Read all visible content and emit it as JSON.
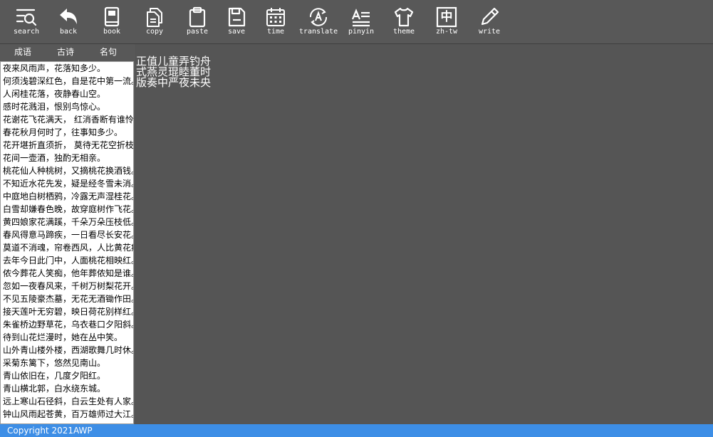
{
  "toolbar": {
    "items": [
      {
        "label": "search",
        "icon": "search-icon"
      },
      {
        "label": "back",
        "icon": "back-arrow-icon"
      },
      {
        "label": "book",
        "icon": "book-icon"
      },
      {
        "label": "copy",
        "icon": "copy-icon"
      },
      {
        "label": "paste",
        "icon": "clipboard-icon"
      },
      {
        "label": "save",
        "icon": "save-icon"
      },
      {
        "label": "time",
        "icon": "calendar-icon"
      },
      {
        "label": "translate",
        "icon": "translate-icon"
      },
      {
        "label": "pinyin",
        "icon": "pinyin-icon"
      },
      {
        "label": "theme",
        "icon": "shirt-icon"
      },
      {
        "label": "zh-tw",
        "icon": "zh-tw-icon",
        "glyph": "中"
      },
      {
        "label": "write",
        "icon": "pencil-icon"
      }
    ]
  },
  "sidebar": {
    "tabs": [
      "成语",
      "古诗",
      "名句"
    ],
    "items": [
      "夜来风雨声，花落知多少。",
      "何须浅碧深红色，自是花中第一流。",
      "人闲桂花落，夜静春山空。",
      "感时花溅泪，恨别鸟惊心。",
      "花谢花飞花满天， 红消香断有谁怜",
      "春花秋月何时了，往事知多少。",
      "花开堪折直须折， 莫待无花空折枝",
      "花间一壶酒，独酌无相亲。",
      "桃花仙人种桃树，又摘桃花换酒钱。",
      "不知近水花先发，疑是经冬雪未消。",
      "中庭地白树栖鸦，冷露无声湿桂花。",
      "白雪却嫌春色晚，故穿庭树作飞花。",
      "黄四娘家花满蹊，千朵万朵压枝低。",
      "春风得意马蹄疾，一日看尽长安花。",
      "莫道不消魂，帘卷西风，人比黄花瘦",
      "去年今日此门中，人面桃花相映红。",
      "侬今葬花人笑痴，他年葬侬知是谁。",
      "忽如一夜春风来，千树万树梨花开。",
      "不见五陵豪杰墓，无花无酒锄作田。",
      "接天莲叶无穷碧，映日荷花别样红。",
      "朱雀桥边野草花，乌衣巷口夕阳斜。",
      "待到山花烂漫时，她在丛中笑。",
      "山外青山楼外楼，西湖歌舞几时休。",
      "采菊东篱下，悠然见南山。",
      "青山依旧在，几度夕阳红。",
      "青山横北郭，白水绕东城。",
      "远上寒山石径斜，白云生处有人家。",
      "钟山风雨起苍黄，百万雄师过大江。"
    ]
  },
  "main": {
    "lines": [
      "正值儿童弄钓舟",
      "式燕灵琨睦董时",
      "版奏中严夜未央"
    ]
  },
  "footer": {
    "text": "Copyright 2021AWP"
  },
  "colors": {
    "toolbar_bg": "#585858",
    "main_bg": "#555555",
    "footer_bg": "#3d8ee6"
  }
}
